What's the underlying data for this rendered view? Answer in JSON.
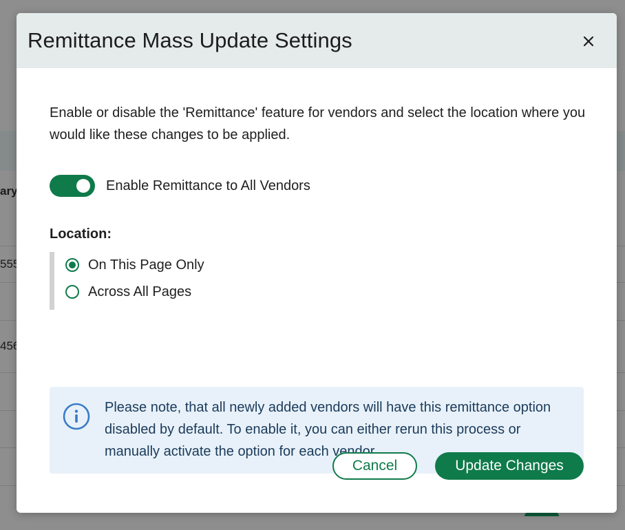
{
  "background": {
    "fragments": [
      "ary",
      "555",
      "456"
    ]
  },
  "modal": {
    "title": "Remittance Mass Update Settings",
    "close_icon": "close-icon",
    "intro": "Enable or disable the 'Remittance' feature for vendors and select the location where you would like these changes to be applied.",
    "toggle": {
      "label": "Enable Remittance to All Vendors",
      "enabled": true
    },
    "location": {
      "label": "Location:",
      "options": [
        {
          "label": "On This Page Only",
          "checked": true
        },
        {
          "label": "Across All Pages",
          "checked": false
        }
      ]
    },
    "note": {
      "icon": "info-icon",
      "text": "Please note, that all newly added vendors will have this remittance option disabled by default. To enable it, you can either rerun this process or manually activate the option for each vendor."
    },
    "buttons": {
      "cancel": "Cancel",
      "update": "Update Changes"
    }
  },
  "colors": {
    "accent": "#0f7a4a",
    "header_bg": "#e4ebea",
    "note_bg": "#e8f1f9",
    "note_text": "#1a3a5a"
  }
}
